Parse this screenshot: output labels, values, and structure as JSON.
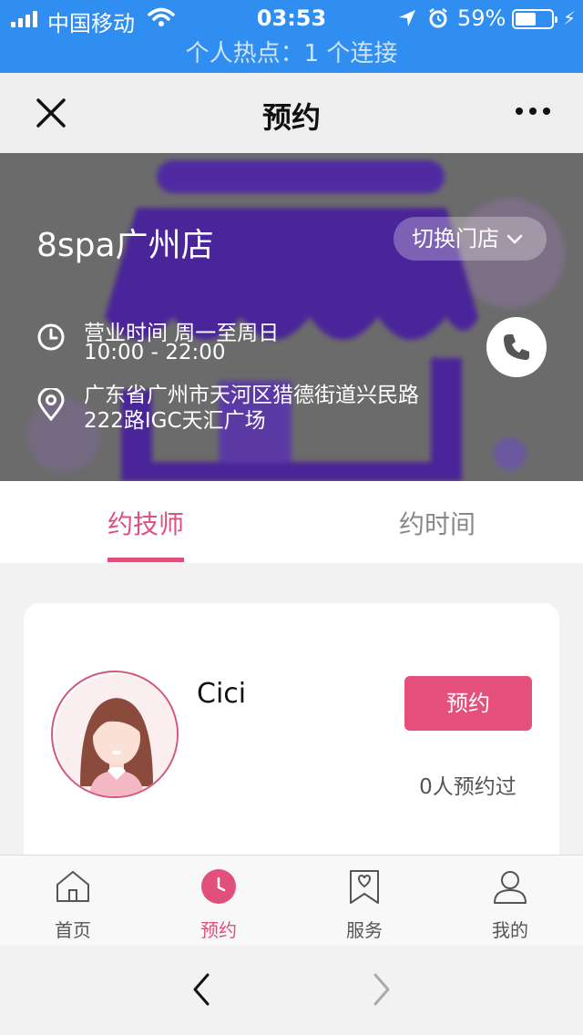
{
  "status_bar": {
    "carrier": "中国移动",
    "time": "03:53",
    "battery_percent": "59%",
    "battery_level": 0.59,
    "hotspot": "个人热点：1 个连接"
  },
  "nav": {
    "title": "预约"
  },
  "store": {
    "name": "8spa广州店",
    "switch_label": "切换门店",
    "hours_label": "营业时间 周一至周日",
    "hours_time": "10:00 - 22:00",
    "address": "广东省广州市天河区猎德街道兴民路222路IGC天汇广场"
  },
  "tabs": [
    {
      "label": "约技师",
      "active": true
    },
    {
      "label": "约时间",
      "active": false
    }
  ],
  "technician": {
    "name": "Cici",
    "book_label": "预约",
    "booked_count": "0人预约过"
  },
  "tabbar": [
    {
      "label": "首页",
      "icon": "home-icon"
    },
    {
      "label": "预约",
      "icon": "clock-icon"
    },
    {
      "label": "服务",
      "icon": "service-icon"
    },
    {
      "label": "我的",
      "icon": "user-icon"
    }
  ],
  "colors": {
    "status_bar": "#2f8ef0",
    "accent": "#e0507a",
    "store_overlay": "#6a6a6a"
  }
}
